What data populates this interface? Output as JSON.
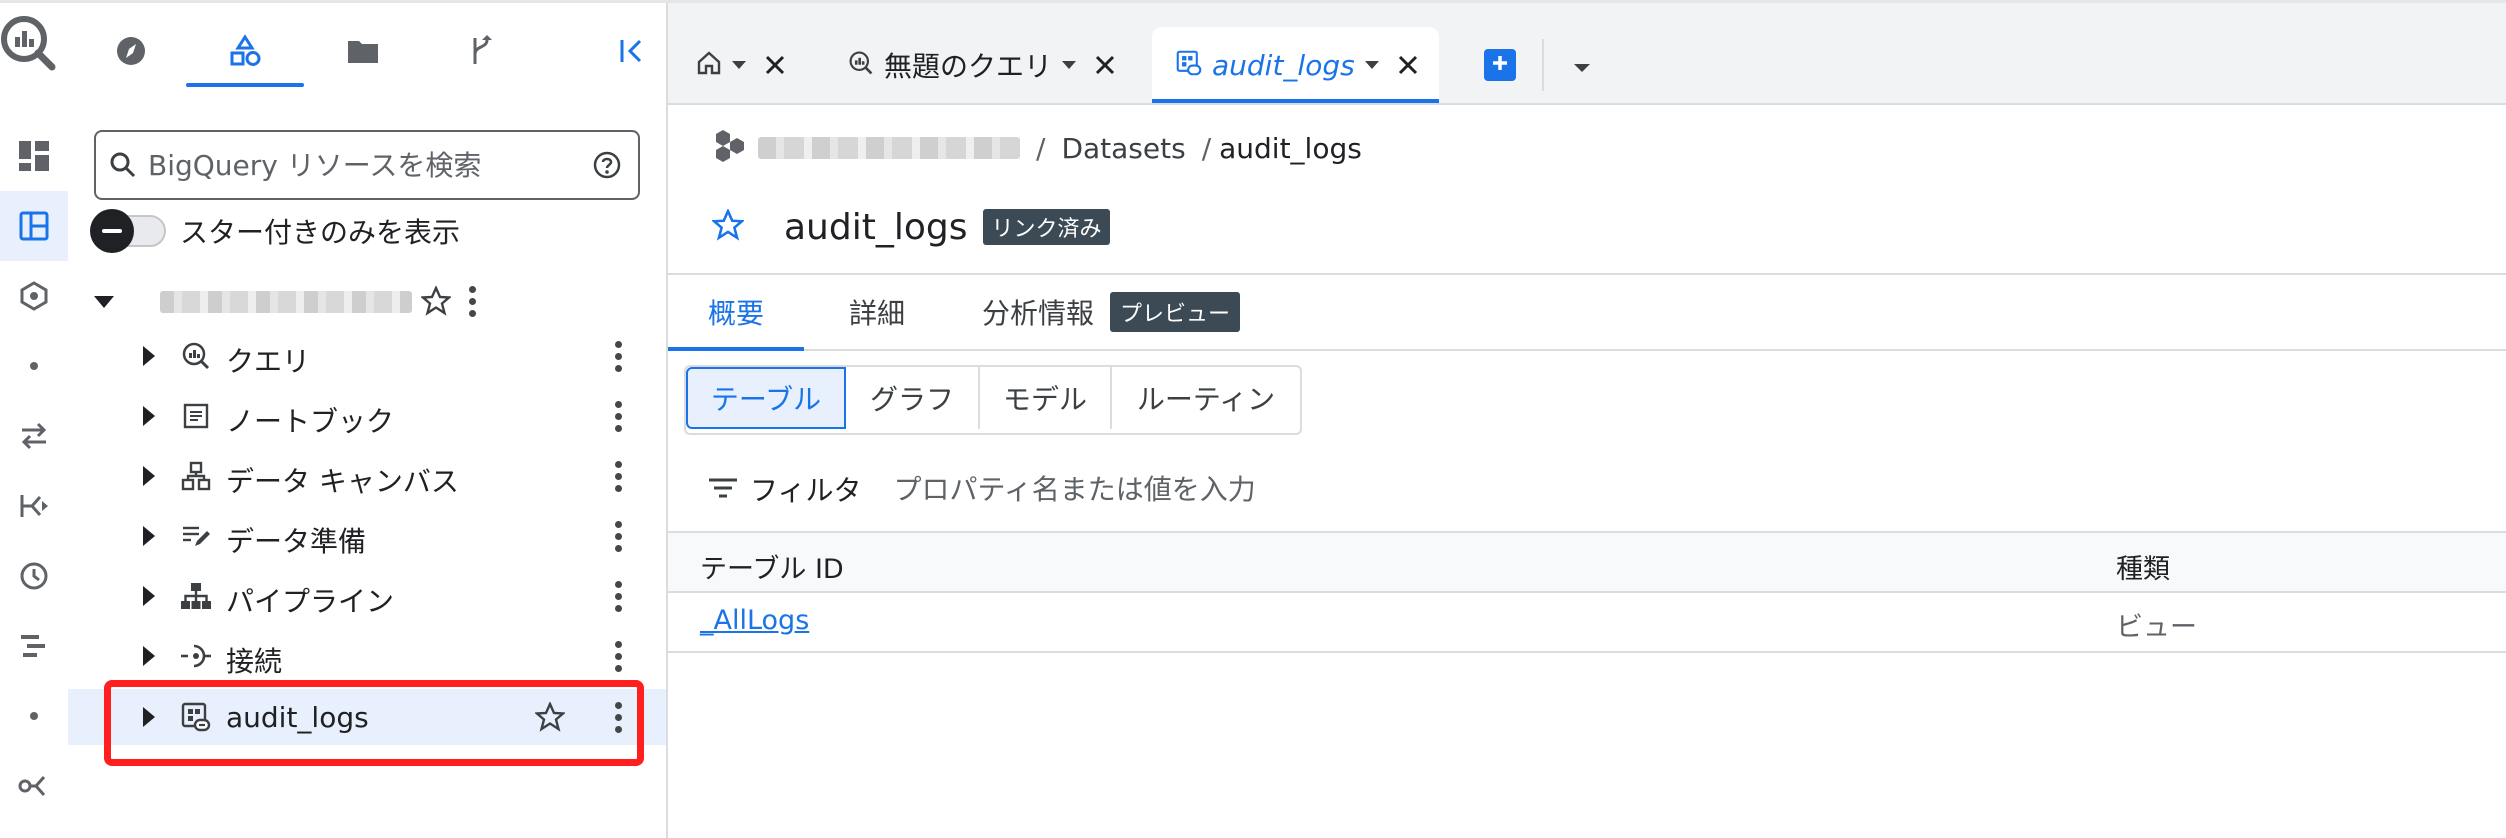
{
  "search": {
    "placeholder": "BigQuery リソースを検索"
  },
  "starred_toggle": {
    "label": "スター付きのみを表示"
  },
  "tree": {
    "items": [
      {
        "label": "クエリ"
      },
      {
        "label": "ノートブック"
      },
      {
        "label": "データ キャンバス"
      },
      {
        "label": "データ準備"
      },
      {
        "label": "パイプライン"
      },
      {
        "label": "接続"
      },
      {
        "label": "audit_logs"
      }
    ]
  },
  "tabs": [
    {
      "label": "無題のクエリ"
    },
    {
      "label": "audit_logs"
    }
  ],
  "breadcrumb": {
    "sep1": "/",
    "datasets": "Datasets",
    "sep2": "/",
    "dataset": "audit_logs"
  },
  "header": {
    "title": "audit_logs",
    "badge": "リンク済み"
  },
  "content_tabs": [
    {
      "label": "概要"
    },
    {
      "label": "詳細"
    },
    {
      "label": "分析情報"
    }
  ],
  "preview_badge": "プレビュー",
  "segments": [
    {
      "label": "テーブル"
    },
    {
      "label": "グラフ"
    },
    {
      "label": "モデル"
    },
    {
      "label": "ルーティン"
    }
  ],
  "filter": {
    "label": "フィルタ",
    "placeholder": "プロパティ名または値を入力"
  },
  "table": {
    "columns": [
      "テーブル ID",
      "種類"
    ],
    "rows": [
      [
        "_AllLogs",
        "ビュー"
      ]
    ]
  },
  "colors": {
    "accent": "#1a73e8",
    "highlight": "#ff1f1f",
    "badge": "#3c4a55"
  }
}
